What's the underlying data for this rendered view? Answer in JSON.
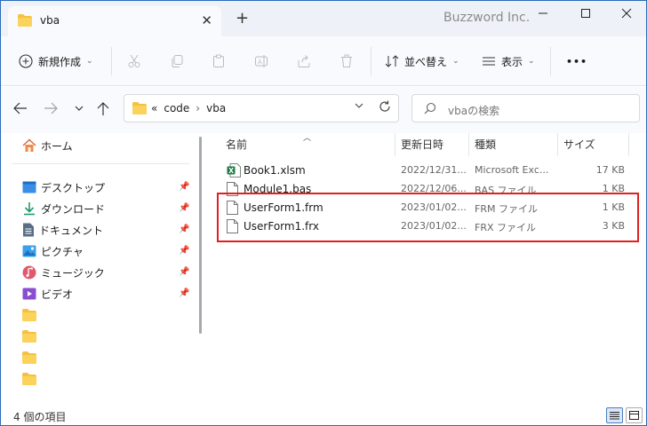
{
  "window": {
    "tab_title": "vba",
    "watermark": "Buzzword Inc.",
    "controls": [
      "minimize",
      "maximize",
      "close"
    ]
  },
  "toolbar": {
    "new_label": "新規作成",
    "sort_label": "並べ替え",
    "view_label": "表示",
    "more_label": "•••"
  },
  "address": {
    "crumbs": [
      "«",
      "code",
      "›",
      "vba"
    ],
    "search_placeholder": "vbaの検索"
  },
  "nav": {
    "home": "ホーム",
    "items": [
      {
        "label": "デスクトップ",
        "icon": "desktop-icon",
        "pinned": true
      },
      {
        "label": "ダウンロード",
        "icon": "download-icon",
        "pinned": true
      },
      {
        "label": "ドキュメント",
        "icon": "document-icon",
        "pinned": true
      },
      {
        "label": "ピクチャ",
        "icon": "pictures-icon",
        "pinned": true
      },
      {
        "label": "ミュージック",
        "icon": "music-icon",
        "pinned": true
      },
      {
        "label": "ビデオ",
        "icon": "video-icon",
        "pinned": true
      }
    ],
    "folder_count_shown": 4
  },
  "list": {
    "columns": [
      "名前",
      "更新日時",
      "種類",
      "サイズ"
    ],
    "rows": [
      {
        "name": "Book1.xlsm",
        "date": "2022/12/31...",
        "type": "Microsoft Exc...",
        "size": "17 KB",
        "icon": "excel-file-icon"
      },
      {
        "name": "Module1.bas",
        "date": "2022/12/06...",
        "type": "BAS ファイル",
        "size": "1 KB",
        "icon": "file-icon"
      },
      {
        "name": "UserForm1.frm",
        "date": "2023/01/02...",
        "type": "FRM ファイル",
        "size": "1 KB",
        "icon": "file-icon"
      },
      {
        "name": "UserForm1.frx",
        "date": "2023/01/02...",
        "type": "FRX ファイル",
        "size": "3 KB",
        "icon": "file-icon"
      }
    ]
  },
  "status": {
    "count_text": "4 個の項目"
  },
  "colors": {
    "accent": "#2b6cb8",
    "highlight_box": "#e02020",
    "folder": "#f4c240"
  }
}
